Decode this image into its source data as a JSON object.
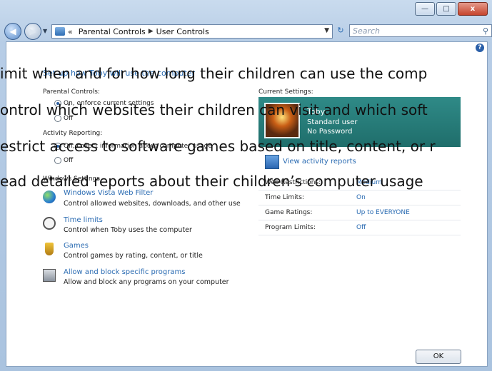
{
  "window": {
    "caption_buttons": {
      "minimize": "—",
      "maximize": "□",
      "close": "x"
    }
  },
  "toolbar": {
    "back_glyph": "◀",
    "forward_glyph": "▶",
    "breadcrumb": {
      "chevrons": "«",
      "part1": "Parental Controls",
      "separator": "▶",
      "part2": "User Controls"
    },
    "refresh_glyph": "↻",
    "search_placeholder": "Search"
  },
  "overlay_lines": [
    "imit when and for how long their children can use the comp",
    "ontrol which websites their children can visit and which soft",
    "estrict access to software games based on title, content, or r",
    "ead detailed reports about their children’s computer usage"
  ],
  "page": {
    "header": "Set up how Toby will use the computer",
    "parental_controls_label": "Parental Controls:",
    "pc_on": "On, enforce current settings",
    "pc_off": "Off",
    "activity_label": "Activity Reporting:",
    "ar_on": "On, collect information about computer usage",
    "ar_off": "Off",
    "windows_settings_label": "Windows Settings",
    "windows_settings": [
      {
        "link": "Windows Vista Web Filter",
        "desc": "Control allowed websites, downloads, and other use"
      },
      {
        "link": "Time limits",
        "desc": "Control when Toby uses the computer"
      },
      {
        "link": "Games",
        "desc": "Control games by rating, content, or title"
      },
      {
        "link": "Allow and block specific programs",
        "desc": "Allow and block any programs on your computer"
      }
    ],
    "current_settings_label": "Current Settings:",
    "user": {
      "name": "Toby",
      "type": "Standard user",
      "password": "No Password"
    },
    "activity_link": "View activity reports",
    "settings": [
      {
        "key": "Web Restrictions:",
        "value": "Medium"
      },
      {
        "key": "Time Limits:",
        "value": "On"
      },
      {
        "key": "Game Ratings:",
        "value": "Up to EVERYONE"
      },
      {
        "key": "Program Limits:",
        "value": "Off"
      }
    ],
    "ok_label": "OK",
    "help_glyph": "?"
  },
  "colors": {
    "link": "#2a6bb2",
    "user_card": "#1f6e6b"
  }
}
